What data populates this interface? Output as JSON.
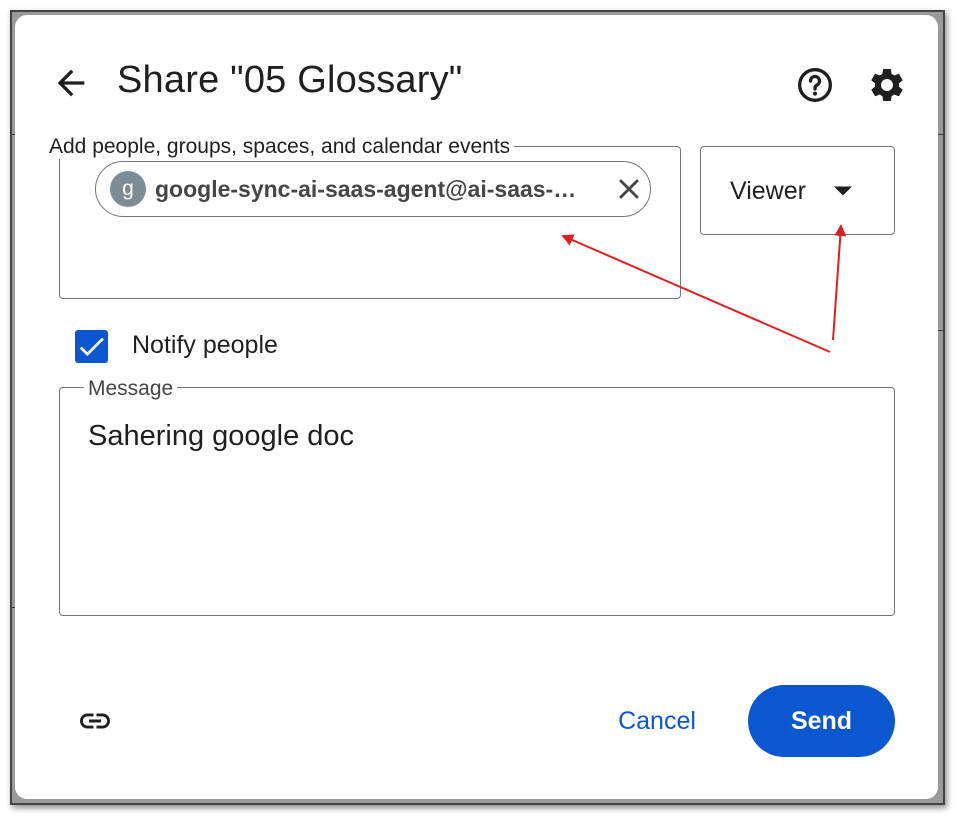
{
  "dialog": {
    "title": "Share \"05 Glossary\""
  },
  "people": {
    "label": "Add people, groups, spaces, and calendar events",
    "chip": {
      "avatar_letter": "g",
      "email": "google-sync-ai-saas-agent@ai-saas-…"
    }
  },
  "role": {
    "selected": "Viewer"
  },
  "notify": {
    "label": "Notify people",
    "checked": true
  },
  "message": {
    "label": "Message",
    "value": "Sahering google doc"
  },
  "footer": {
    "cancel_label": "Cancel",
    "send_label": "Send"
  },
  "icons": {
    "back": "arrow-back-icon",
    "help": "help-icon",
    "settings": "gear-icon",
    "remove": "close-icon",
    "dropdown": "caret-down-icon",
    "check": "checkmark-icon",
    "link": "link-icon"
  },
  "colors": {
    "primary": "#0b57d0",
    "annotation_arrow": "#e02020",
    "avatar": "#7d8b94"
  }
}
